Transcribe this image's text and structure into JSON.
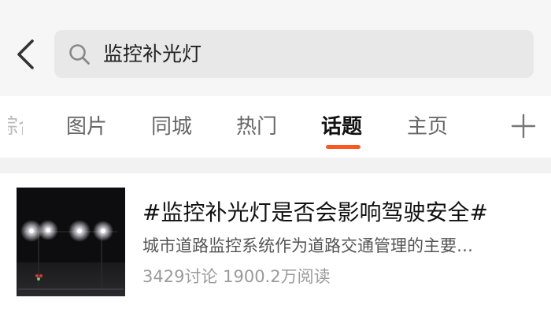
{
  "search": {
    "query": "监控补光灯"
  },
  "icons": {
    "back": "back-arrow-icon",
    "search": "search-icon",
    "add": "plus-icon"
  },
  "tabs": {
    "partial_label": "综合",
    "items": [
      {
        "label": "图片",
        "active": false
      },
      {
        "label": "同城",
        "active": false
      },
      {
        "label": "热门",
        "active": false
      },
      {
        "label": "话题",
        "active": true
      },
      {
        "label": "主页",
        "active": false
      }
    ],
    "underline_color": "#ff5722"
  },
  "result": {
    "title": "#监控补光灯是否会影响驾驶安全#",
    "description": "城市道路监控系统作为道路交通管理的主要…",
    "stats": "3429讨论 1900.2万阅读"
  }
}
